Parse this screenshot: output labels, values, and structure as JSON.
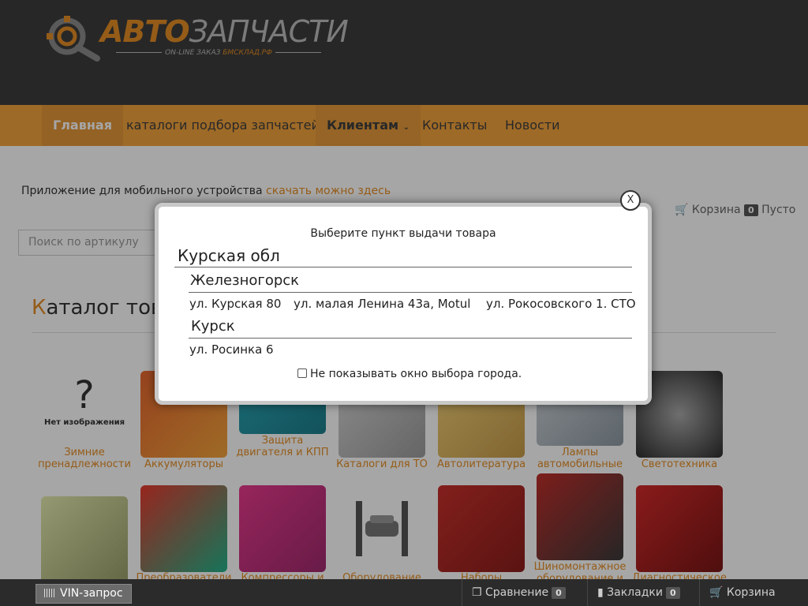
{
  "logo": {
    "brand_a": "АВТО",
    "brand_b": "ЗАПЧАСТИ",
    "tagline": "ON-LINE ЗАКАЗ ",
    "tagline_site": "БМСКЛАД.РФ"
  },
  "nav": {
    "items": [
      {
        "label": "Главная"
      },
      {
        "label": "каталоги подбора запчастей"
      },
      {
        "label": "Клиентам"
      },
      {
        "label": "Контакты"
      },
      {
        "label": "Новости"
      }
    ]
  },
  "content": {
    "app_text": "Приложение для мобильного устройства ",
    "app_link": "скачать можно здесь",
    "search_placeholder": "Поиск по артикулу",
    "cart_label": "Корзина",
    "cart_count": "0",
    "cart_status": "Пусто",
    "catalog_title_first": "К",
    "catalog_title_rest": "аталог това",
    "no_image": "Нет изображения",
    "tiles_row1": [
      "Зимние пренадлежности",
      "Аккумуляторы",
      "Защита двигателя и КПП",
      "Каталоги для ТО",
      "Автолитература",
      "Лампы автомобильные",
      "Светотехника"
    ],
    "tiles_row2": [
      "",
      "Преобразователи",
      "Компрессоры и",
      "Оборудование",
      "Наборы",
      "Шиномонтажное оборудование и",
      "Диагностическое"
    ]
  },
  "modal": {
    "title": "Выберите пункт выдачи товара",
    "close_label": "X",
    "region": "Курская обл",
    "city1": "Железногорск",
    "city1_addresses": [
      "ул. Курская 80",
      "ул. малая Ленина 43а, Motul",
      "ул. Рокосовского 1. СТО"
    ],
    "city2": "Курск",
    "city2_addresses": [
      "ул. Росинка 6"
    ],
    "checkbox_label": "Не показывать окно выбора города."
  },
  "footer": {
    "vin_label": "VIN-запрос",
    "compare_label": "Сравнение",
    "compare_count": "0",
    "bookmarks_label": "Закладки",
    "bookmarks_count": "0",
    "cart_label": "Корзина"
  },
  "colors": {
    "accent": "#e58e26",
    "header_bg": "#3c3c3c",
    "nav_bg": "#f3a43c",
    "footer_bg": "#2b2b2b"
  }
}
